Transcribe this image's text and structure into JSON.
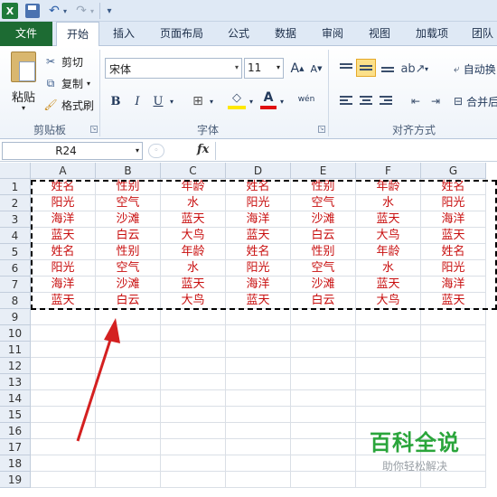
{
  "quick_access": {
    "excel_glyph": "X"
  },
  "tabs": [
    {
      "label": "文件"
    },
    {
      "label": "开始"
    },
    {
      "label": "插入"
    },
    {
      "label": "页面布局"
    },
    {
      "label": "公式"
    },
    {
      "label": "数据"
    },
    {
      "label": "审阅"
    },
    {
      "label": "视图"
    },
    {
      "label": "加载项"
    },
    {
      "label": "团队"
    }
  ],
  "clipboard": {
    "paste": "粘贴",
    "cut": "剪切",
    "copy": "复制",
    "format_painter": "格式刷",
    "group_label": "剪贴板"
  },
  "font": {
    "name": "宋体",
    "size": "11",
    "grow": "A",
    "shrink": "A",
    "bold": "B",
    "italic": "I",
    "underline": "U",
    "font_color": "A",
    "phonetic": "wén",
    "group_label": "字体"
  },
  "alignment": {
    "wrap_text": "自动换",
    "merge": "合并后",
    "group_label": "对齐方式"
  },
  "formula_bar": {
    "name_box": "R24",
    "fx": "fx",
    "value": ""
  },
  "sheet": {
    "columns": [
      "A",
      "B",
      "C",
      "D",
      "E",
      "F",
      "G"
    ],
    "row_numbers": [
      "1",
      "2",
      "3",
      "4",
      "5",
      "6",
      "7",
      "8",
      "9",
      "10",
      "11",
      "12",
      "13",
      "14",
      "15",
      "16",
      "17",
      "18",
      "19"
    ],
    "rows": [
      [
        "姓名",
        "性别",
        "年龄",
        "姓名",
        "性别",
        "年龄",
        "姓名"
      ],
      [
        "阳光",
        "空气",
        "水",
        "阳光",
        "空气",
        "水",
        "阳光"
      ],
      [
        "海洋",
        "沙滩",
        "蓝天",
        "海洋",
        "沙滩",
        "蓝天",
        "海洋"
      ],
      [
        "蓝天",
        "白云",
        "大鸟",
        "蓝天",
        "白云",
        "大鸟",
        "蓝天"
      ],
      [
        "姓名",
        "性别",
        "年龄",
        "姓名",
        "性别",
        "年龄",
        "姓名"
      ],
      [
        "阳光",
        "空气",
        "水",
        "阳光",
        "空气",
        "水",
        "阳光"
      ],
      [
        "海洋",
        "沙滩",
        "蓝天",
        "海洋",
        "沙滩",
        "蓝天",
        "海洋"
      ],
      [
        "蓝天",
        "白云",
        "大鸟",
        "蓝天",
        "白云",
        "大鸟",
        "蓝天"
      ]
    ],
    "cell_text_color": "#c80f0f"
  },
  "watermark": {
    "title": "百科全说",
    "subtitle": "助你轻松解决"
  },
  "colors": {
    "file_tab": "#1d6b33",
    "arrow": "#d42020",
    "watermark": "#2aa53b"
  }
}
